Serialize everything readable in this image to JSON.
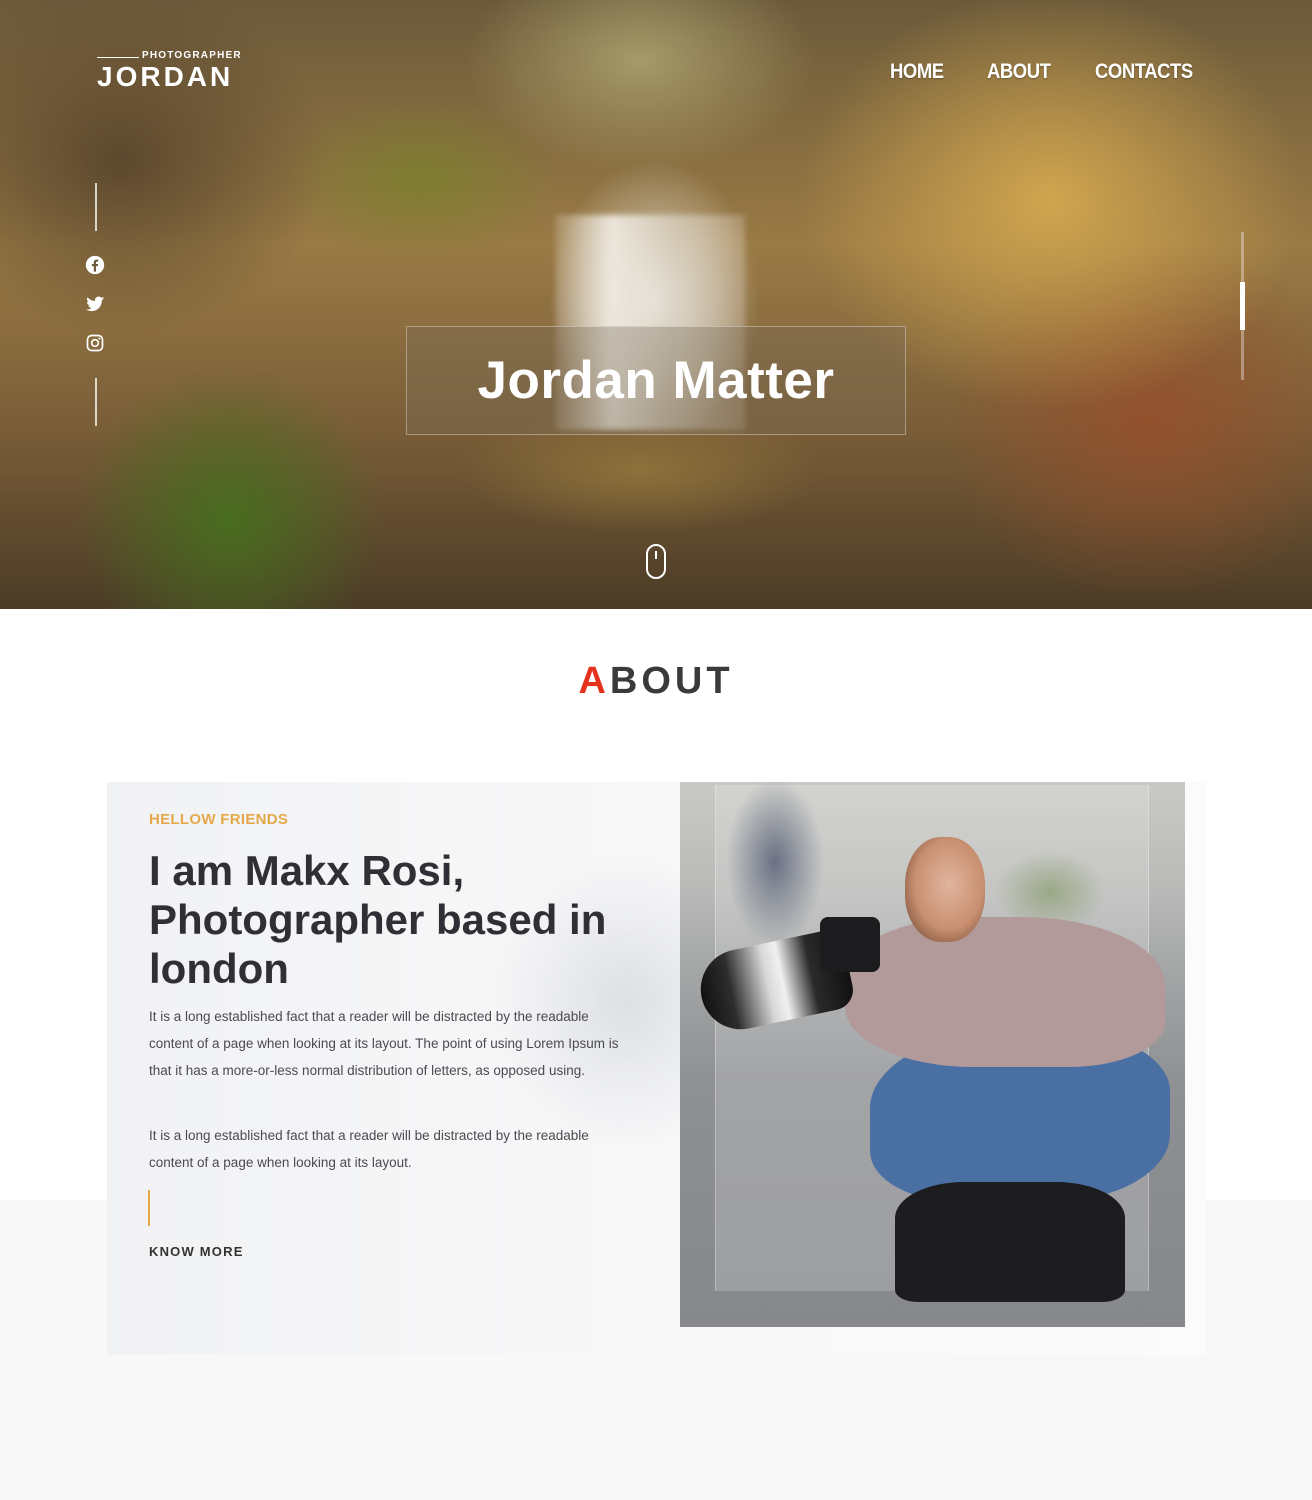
{
  "header": {
    "brand_tag": "PHOTOGRAPHER",
    "brand_name": "JORDAN",
    "nav": [
      {
        "label": "HOME"
      },
      {
        "label": "ABOUT"
      },
      {
        "label": "CONTACTS"
      }
    ]
  },
  "hero": {
    "title": "Jordan Matter",
    "social_icons": [
      "facebook-icon",
      "twitter-icon",
      "instagram-icon"
    ],
    "scroll_icon": "mouse-scroll-icon"
  },
  "about": {
    "section_title_first_letter": "A",
    "section_title_rest": "BOUT",
    "eyebrow": "HELLOW FRIENDS",
    "headline": "I am Makx Rosi, Photographer based in london",
    "paragraph1": "It is a long established fact that a reader will be distracted by the readable content of a page when looking at its layout. The point of using Lorem Ipsum is that it has a more-or-less normal distribution of letters, as opposed using.",
    "paragraph2": "It is a long established fact that a reader will be distracted by the readable content of a page when looking at its layout.",
    "cta": "KNOW MORE"
  },
  "colors": {
    "accent_red": "#e5321f",
    "accent_gold": "#e4a84a",
    "heading_dark": "#2f2f35"
  }
}
